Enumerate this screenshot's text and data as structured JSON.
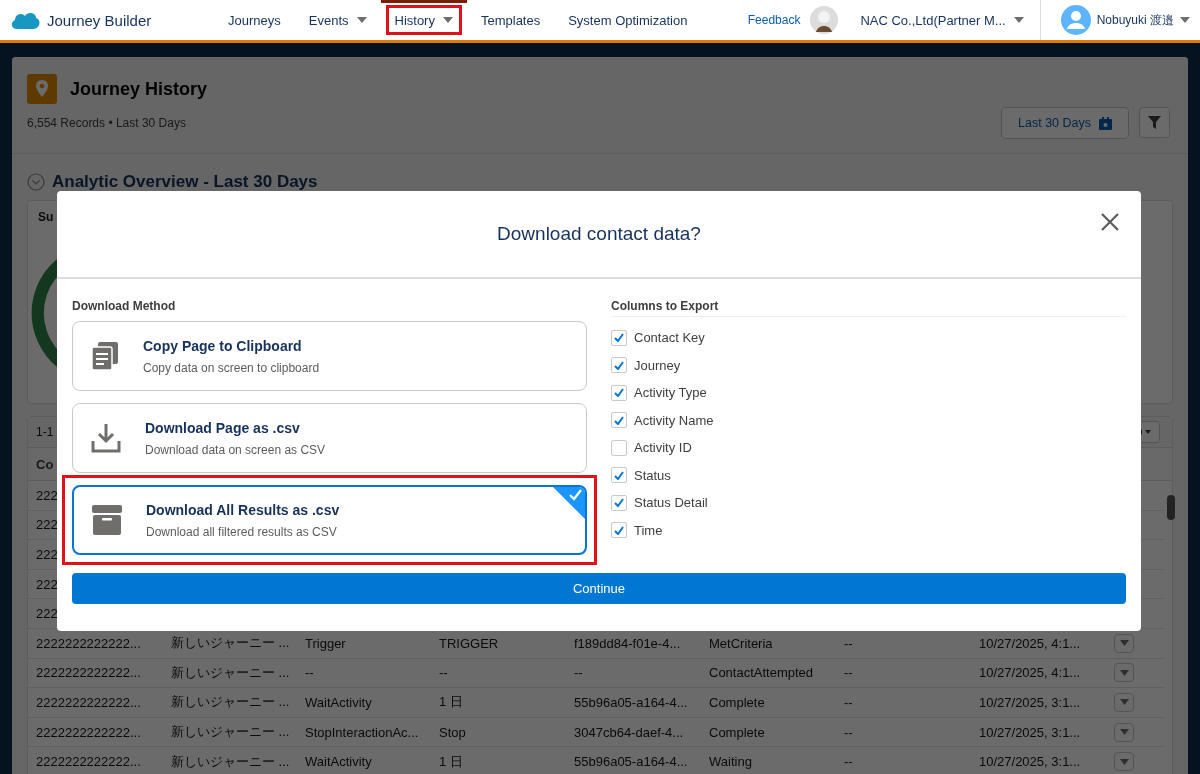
{
  "app": {
    "name": "Journey Builder"
  },
  "nav": [
    {
      "label": "Journeys",
      "dropdown": false,
      "selected": false,
      "highlighted": false
    },
    {
      "label": "Events",
      "dropdown": true,
      "selected": false,
      "highlighted": false
    },
    {
      "label": "History",
      "dropdown": true,
      "selected": true,
      "highlighted": true
    },
    {
      "label": "Templates",
      "dropdown": false,
      "selected": false,
      "highlighted": false
    },
    {
      "label": "System Optimization",
      "dropdown": false,
      "selected": false,
      "highlighted": false
    }
  ],
  "header_right": {
    "feedback": "Feedback",
    "org": "NAC Co.,Ltd(Partner M...",
    "user": "Nobuyuki 渡邉"
  },
  "page": {
    "title": "Journey History",
    "subtitle": "6,554 Records • Last 30 Days",
    "date_button": "Last 30 Days"
  },
  "overview": {
    "title": "Analytic Overview - Last 30 Days",
    "panel_title": "Su"
  },
  "table": {
    "range": "1-1",
    "header": "Co",
    "rows": [
      {
        "cells": [
          "222"
        ]
      },
      {
        "cells": [
          "222"
        ]
      },
      {
        "cells": [
          "222"
        ]
      },
      {
        "cells": [
          "222"
        ]
      },
      {
        "cells": [
          "222"
        ]
      },
      {
        "cells": [
          "2222222222222...",
          "新しいジャーニー ...",
          "Trigger",
          "TRIGGER",
          "f189dd84-f01e-4...",
          "MetCriteria",
          "--",
          "10/27/2025, 4:1..."
        ]
      },
      {
        "cells": [
          "2222222222222...",
          "新しいジャーニー ...",
          "--",
          "--",
          "--",
          "ContactAttempted",
          "--",
          "10/27/2025, 4:1..."
        ]
      },
      {
        "cells": [
          "2222222222222...",
          "新しいジャーニー ...",
          "WaitActivity",
          "1 日",
          "55b96a05-a164-4...",
          "Complete",
          "--",
          "10/27/2025, 3:1..."
        ]
      },
      {
        "cells": [
          "2222222222222...",
          "新しいジャーニー ...",
          "StopInteractionAc...",
          "Stop",
          "3047cb64-daef-4...",
          "Complete",
          "--",
          "10/27/2025, 3:1..."
        ]
      },
      {
        "cells": [
          "2222222222222...",
          "新しいジャーニー ...",
          "WaitActivity",
          "1 日",
          "55b96a05-a164-4...",
          "Waiting",
          "--",
          "10/27/2025, 3:1..."
        ]
      }
    ]
  },
  "modal": {
    "title": "Download contact data?",
    "method_label": "Download Method",
    "columns_label": "Columns to Export",
    "options": [
      {
        "kind": "copy",
        "title": "Copy Page to Clipboard",
        "description": "Copy data on screen to clipboard",
        "selected": false,
        "highlighted": false
      },
      {
        "kind": "download",
        "title": "Download Page as .csv",
        "description": "Download data on screen as CSV",
        "selected": false,
        "highlighted": false
      },
      {
        "kind": "archive",
        "title": "Download All Results as .csv",
        "description": "Download all filtered results as CSV",
        "selected": true,
        "highlighted": true
      }
    ],
    "columns": [
      {
        "label": "Contact Key",
        "checked": true
      },
      {
        "label": "Journey",
        "checked": true
      },
      {
        "label": "Activity Type",
        "checked": true
      },
      {
        "label": "Activity Name",
        "checked": true
      },
      {
        "label": "Activity ID",
        "checked": false
      },
      {
        "label": "Status",
        "checked": true
      },
      {
        "label": "Status Detail",
        "checked": true
      },
      {
        "label": "Time",
        "checked": true
      }
    ],
    "button": "Continue"
  }
}
